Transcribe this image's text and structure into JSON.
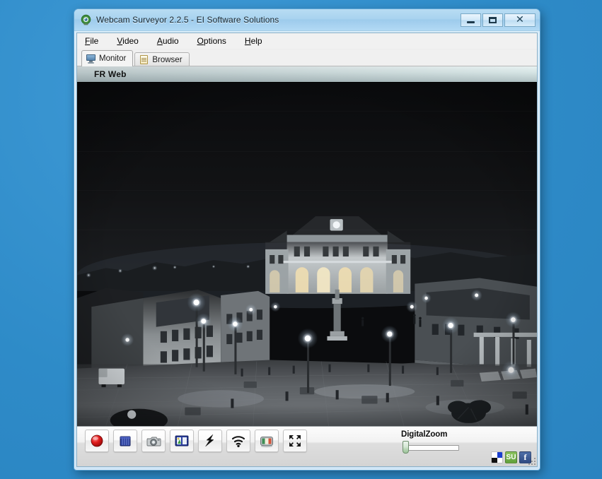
{
  "window": {
    "title": "Webcam Surveyor 2.2.5 - EI Software Solutions",
    "app_icon": "webcam-icon",
    "controls": {
      "minimize": "—",
      "maximize": "□",
      "close": "✕"
    }
  },
  "menubar": {
    "items": [
      {
        "label": "File",
        "accel": "F"
      },
      {
        "label": "Video",
        "accel": "V"
      },
      {
        "label": "Audio",
        "accel": "A"
      },
      {
        "label": "Options",
        "accel": "O"
      },
      {
        "label": "Help",
        "accel": "H"
      }
    ]
  },
  "tabs": [
    {
      "label": "Monitor",
      "icon": "monitor-icon",
      "active": true
    },
    {
      "label": "Browser",
      "icon": "page-icon",
      "active": false
    }
  ],
  "camera": {
    "header_label": "FR Web",
    "scene": "night time city square with illuminated town hall, street lamps and paved plaza"
  },
  "toolbar": {
    "buttons": [
      {
        "name": "record-button",
        "icon": "red-record-icon",
        "title": "Record"
      },
      {
        "name": "stop-button",
        "icon": "blue-stop-icon",
        "title": "Stop"
      },
      {
        "name": "snapshot-button",
        "icon": "camera-icon",
        "title": "Snapshot"
      },
      {
        "name": "film-button",
        "icon": "film-strip-icon",
        "title": "Video files"
      },
      {
        "name": "motion-button",
        "icon": "lightning-icon",
        "title": "Motion detection"
      },
      {
        "name": "broadcast-button",
        "icon": "wifi-icon",
        "title": "Broadcast"
      },
      {
        "name": "monitor-button",
        "icon": "tv-monitor-icon",
        "title": "Monitor"
      },
      {
        "name": "fullscreen-button",
        "icon": "fullscreen-icon",
        "title": "Full screen"
      }
    ],
    "zoom": {
      "label": "DigitalZoom",
      "value": 0,
      "min": 0,
      "max": 100
    },
    "social": [
      {
        "name": "delicious-button",
        "label": "",
        "icon": "delicious-icon"
      },
      {
        "name": "stumbleupon-button",
        "label": "SU",
        "icon": "stumbleupon-icon"
      },
      {
        "name": "facebook-button",
        "label": "f",
        "icon": "facebook-icon"
      }
    ]
  },
  "colors": {
    "desktop": "#2e8bc8",
    "title_bar": "#a9d3ef",
    "record_red": "#d01818",
    "stop_blue": "#2b3f9e",
    "accent_green": "#5fa03a"
  }
}
